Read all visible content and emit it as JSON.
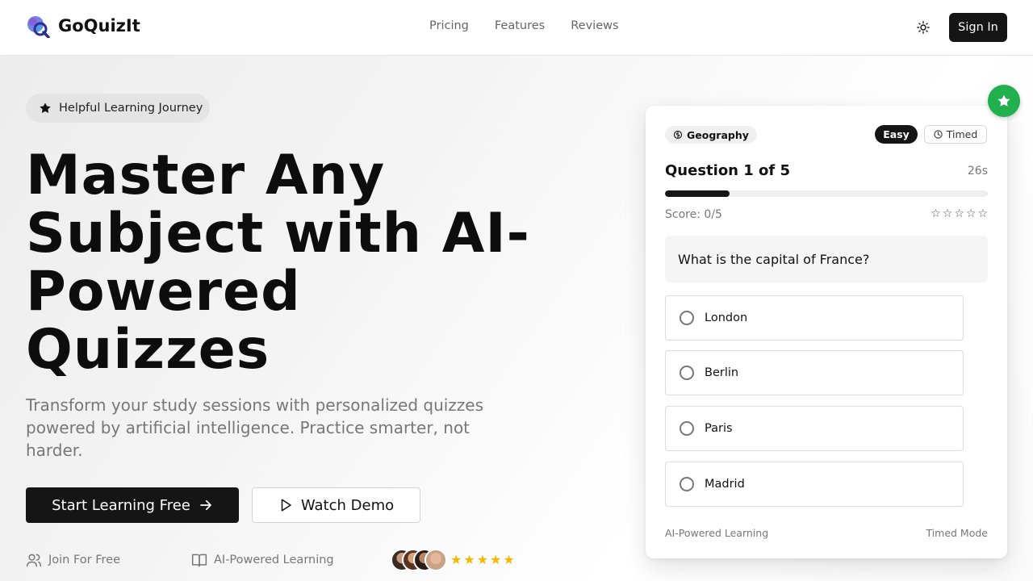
{
  "header": {
    "brand": "GoQuizIt",
    "nav": [
      "Pricing",
      "Features",
      "Reviews"
    ],
    "signin_label": "Sign In",
    "theme_icon": "sun-icon"
  },
  "hero": {
    "pill_label": "Helpful Learning Journey",
    "headline": "Master Any Subject with AI-Powered Quizzes",
    "subheading": "Transform your study sessions with personalized quizzes powered by artificial intelligence. Practice smarter, not harder.",
    "primary_cta": "Start Learning Free",
    "secondary_cta": "Watch Demo",
    "features": [
      "Join For Free",
      "AI-Powered Learning"
    ],
    "rating_stars": 5
  },
  "quiz": {
    "topic": "Geography",
    "difficulty": "Easy",
    "mode_badge": "Timed",
    "question_counter": "Question 1 of 5",
    "timer": "26s",
    "progress_fraction": 0.2,
    "score": "Score: 0/5",
    "rating_stars": 5,
    "question": "What is the capital of France?",
    "options": [
      "London",
      "Berlin",
      "Paris",
      "Madrid"
    ],
    "footer_left": "AI-Powered Learning",
    "footer_right": "Timed Mode"
  },
  "colors": {
    "primary": "#151515",
    "accent_green": "#21b04e",
    "star_gold": "#f5b800",
    "muted_text": "#777777"
  }
}
